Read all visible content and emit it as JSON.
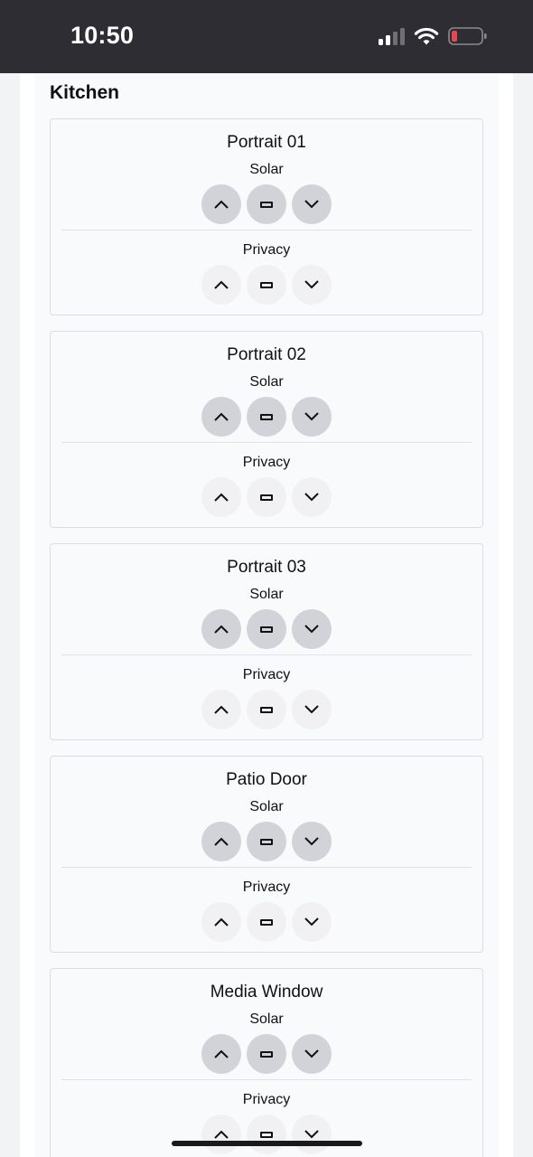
{
  "status_bar": {
    "time": "10:50",
    "icons": [
      "cellular-signal-icon",
      "wifi-icon",
      "battery-low-icon"
    ],
    "battery_color": "#e5484d"
  },
  "room": {
    "title": "Kitchen"
  },
  "windows": [
    {
      "name": "Portrait 01",
      "solar_label": "Solar",
      "privacy_label": "Privacy"
    },
    {
      "name": "Portrait 02",
      "solar_label": "Solar",
      "privacy_label": "Privacy"
    },
    {
      "name": "Portrait 03",
      "solar_label": "Solar",
      "privacy_label": "Privacy"
    },
    {
      "name": "Patio Door",
      "solar_label": "Solar",
      "privacy_label": "Privacy"
    },
    {
      "name": "Media Window",
      "solar_label": "Solar",
      "privacy_label": "Privacy"
    }
  ],
  "controls": [
    "chevron-up-icon",
    "stop-icon",
    "chevron-down-icon"
  ]
}
